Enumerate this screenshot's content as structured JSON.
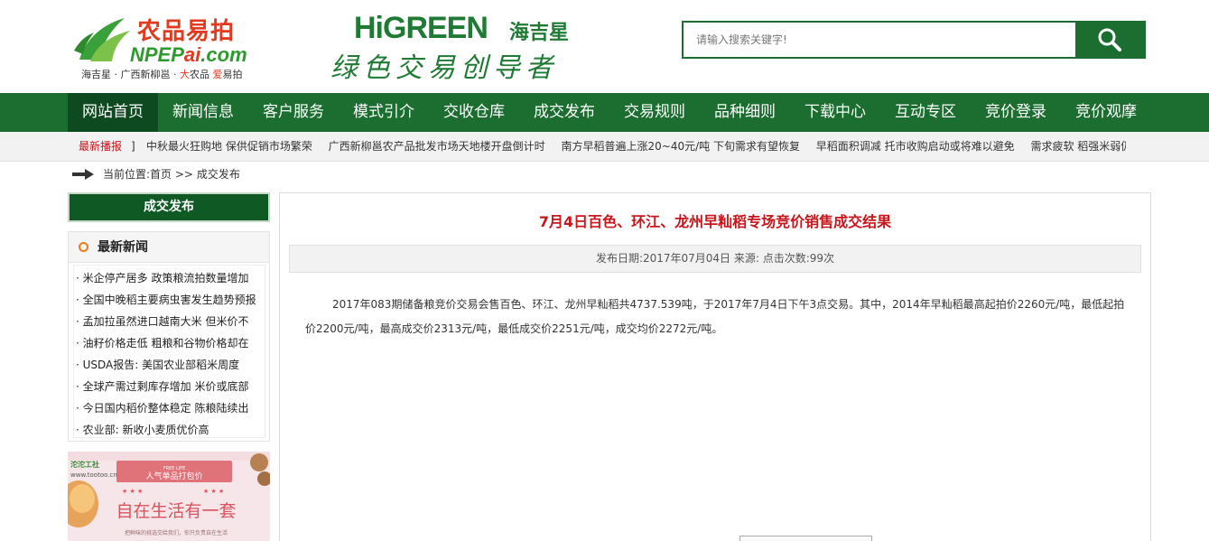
{
  "header": {
    "logo_cn": "农品易拍",
    "logo_en_pre": "NPEP",
    "logo_en_red": "ai",
    "logo_en_post": ".com",
    "logo_tag_pre": "海吉星 · 广西新柳邕 · ",
    "logo_tag_red1": "大",
    "logo_tag_mid": "农品  ",
    "logo_tag_red2": "爱",
    "logo_tag_post": "易拍",
    "brand": "HiGREEN",
    "brand_cn": "海吉星",
    "slogan": "绿色交易创导者",
    "search_placeholder": "请输入搜索关键字!"
  },
  "nav": [
    {
      "label": "网站首页",
      "active": true
    },
    {
      "label": "新闻信息"
    },
    {
      "label": "客户服务"
    },
    {
      "label": "模式引介"
    },
    {
      "label": "交收仓库"
    },
    {
      "label": "成交发布"
    },
    {
      "label": "交易规则"
    },
    {
      "label": "品种细则"
    },
    {
      "label": "下载中心"
    },
    {
      "label": "互动专区"
    },
    {
      "label": "竞价登录"
    },
    {
      "label": "竞价观摩"
    }
  ],
  "ticker": {
    "label": "最新播报",
    "sep": "]",
    "items": [
      "中秋最火狂购地  保供促销市场繁荣",
      "广西新柳邕农产品批发市场天地楼开盘倒计时",
      "南方早稻普遍上涨20~40元/吨  下旬需求有望恢复",
      "早稻面积调减  托市收购启动或将难以避免",
      "需求疲软  稻强米弱仍难"
    ]
  },
  "breadcrumb": {
    "prefix": "当前位置:",
    "home": "首页",
    "sep": " >> ",
    "current": "成交发布"
  },
  "sidebar": {
    "title": "成交发布",
    "news_title": "最新新闻",
    "news": [
      "· 米企停产居多  政策粮流拍数量增加",
      "· 全国中晚稻主要病虫害发生趋势预报",
      "· 孟加拉虽然进口越南大米  但米价不",
      "· 油籽价格走低  粗粮和谷物价格却在",
      "· USDA报告: 美国农业部稻米周度",
      "· 全球产需过剩库存增加  米价或底部",
      "· 今日国内稻价整体稳定  陈粮陆续出",
      "· 农业部: 新收小麦质优价高"
    ],
    "ad": {
      "brand": "沱沱工社",
      "url": "www.tootoo.cn",
      "en": "FREE LIFE",
      "ribbon": "人气单品打包价",
      "headline": "自在生活有一套",
      "footer": "把鲜味的挑选交给我们，你只负责自在生活"
    }
  },
  "article": {
    "title": "7月4日百色、环江、龙州早籼稻专场竞价销售成交结果",
    "meta": "发布日期:2017年07月04日  来源:  点击次数:99次",
    "body": "2017年083期储备粮竞价交易会售百色、环江、龙州早籼稻共4737.539吨，于2017年7月4日下午3点交易。其中，2014年早籼稻最高起拍价2260元/吨，最低起拍价2200元/吨，最高成交价2313元/吨，最低成交价2251元/吨，成交均价2272元/吨。"
  },
  "colors": {
    "nav_green": "#1b6e2f",
    "active_green": "#0e4a1f",
    "title_red": "#c8161d",
    "orange": "#f07a1a"
  }
}
